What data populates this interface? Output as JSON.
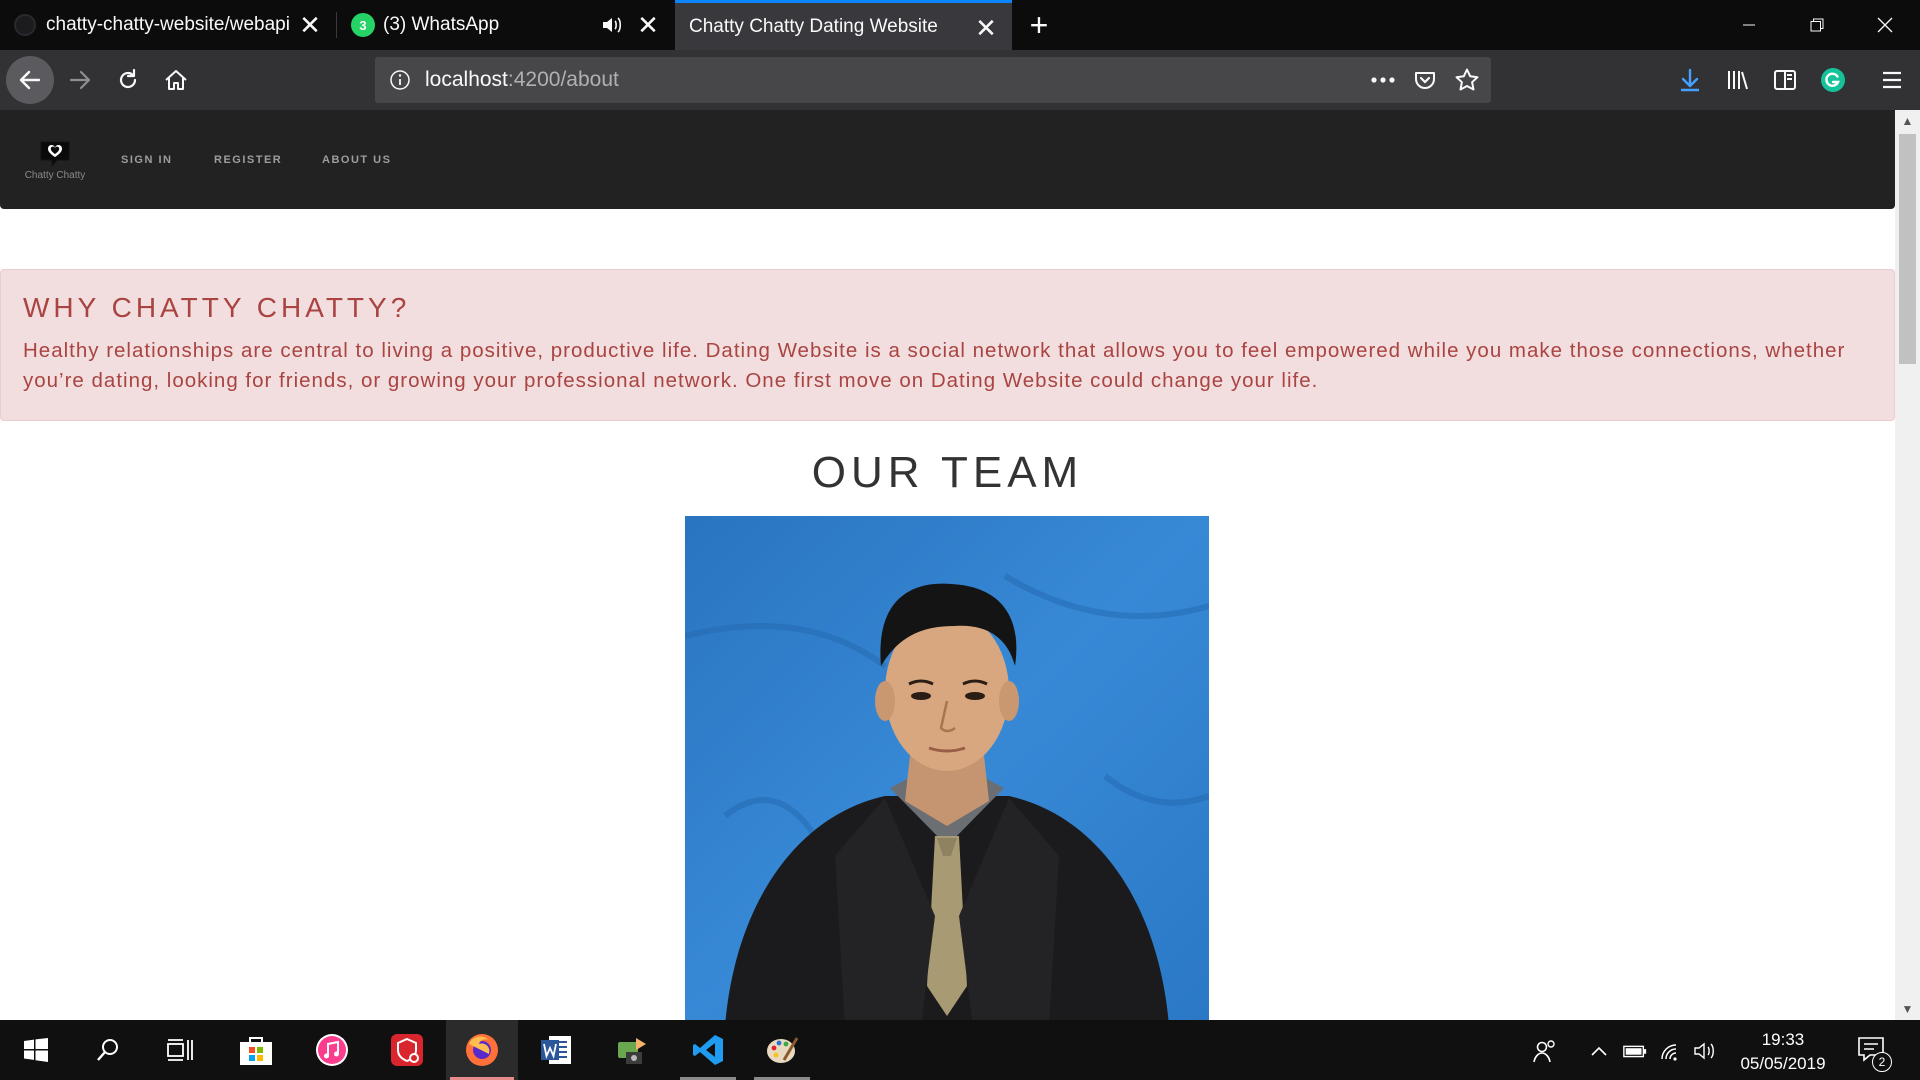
{
  "browser": {
    "tabs": [
      {
        "title": "chatty-chatty-website/webapi",
        "active": false
      },
      {
        "title": "(3) WhatsApp",
        "badge": "3",
        "active": false,
        "audio": true
      },
      {
        "title": "Chatty Chatty Dating Website",
        "active": true
      }
    ],
    "url_host": "localhost",
    "url_path": ":4200/about",
    "accent": "#0a84ff"
  },
  "site": {
    "logo_text": "Chatty Chatty",
    "nav": [
      "SIGN IN",
      "REGISTER",
      "ABOUT US"
    ]
  },
  "alert": {
    "heading": "WHY CHATTY CHATTY?",
    "body": "Healthy relationships are central to living a positive, productive life. Dating Website is a social network that allows you to feel empowered while you make those connections, whether you’re dating, looking for friends, or growing your professional network. One first move on Dating Website could change your life.",
    "color": "#a94442",
    "background": "#f2dede"
  },
  "team": {
    "title": "OUR TEAM"
  },
  "taskbar": {
    "time": "19:33",
    "date": "05/05/2019",
    "notification_count": "2"
  }
}
